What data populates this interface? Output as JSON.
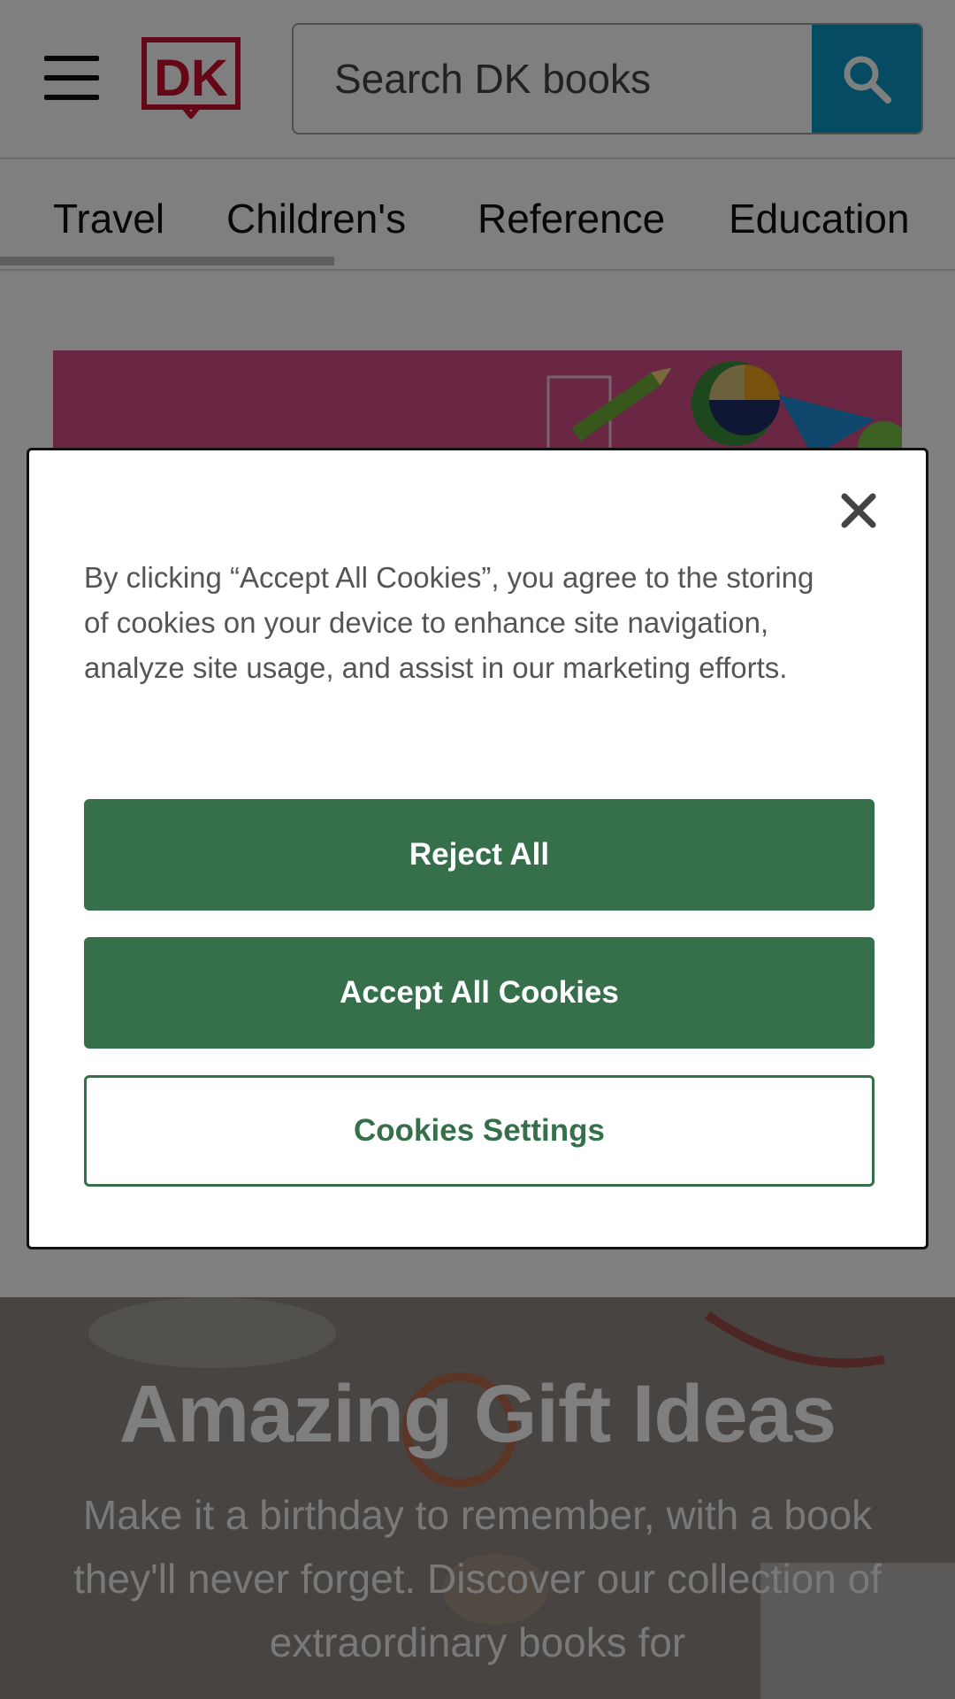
{
  "header": {
    "logo_text": "DK",
    "search_placeholder": "Search DK books",
    "search_button_label": "Search"
  },
  "tabs": [
    {
      "label": "Travel",
      "active": true
    },
    {
      "label": "Children's"
    },
    {
      "label": "Reference"
    },
    {
      "label": "Education"
    }
  ],
  "hero": {
    "title": "Amazing Gift Ideas",
    "text": "Make it a birthday to remember, with a book they'll never forget. Discover our collection of extraordinary books for"
  },
  "cookie_dialog": {
    "message": "By clicking “Accept All Cookies”, you agree to the storing of cookies on your device to enhance site navigation, analyze site usage, and assist in our marketing efforts.",
    "reject_label": "Reject All",
    "accept_label": "Accept All Cookies",
    "settings_label": "Cookies Settings",
    "close_label": "Close"
  },
  "colors": {
    "brand_red": "#c8102e",
    "search_blue": "#0a98c7",
    "button_green": "#35704b",
    "banner_pink": "#d44f86"
  },
  "icons": [
    "menu-icon",
    "dk-logo",
    "search-icon",
    "close-icon"
  ]
}
